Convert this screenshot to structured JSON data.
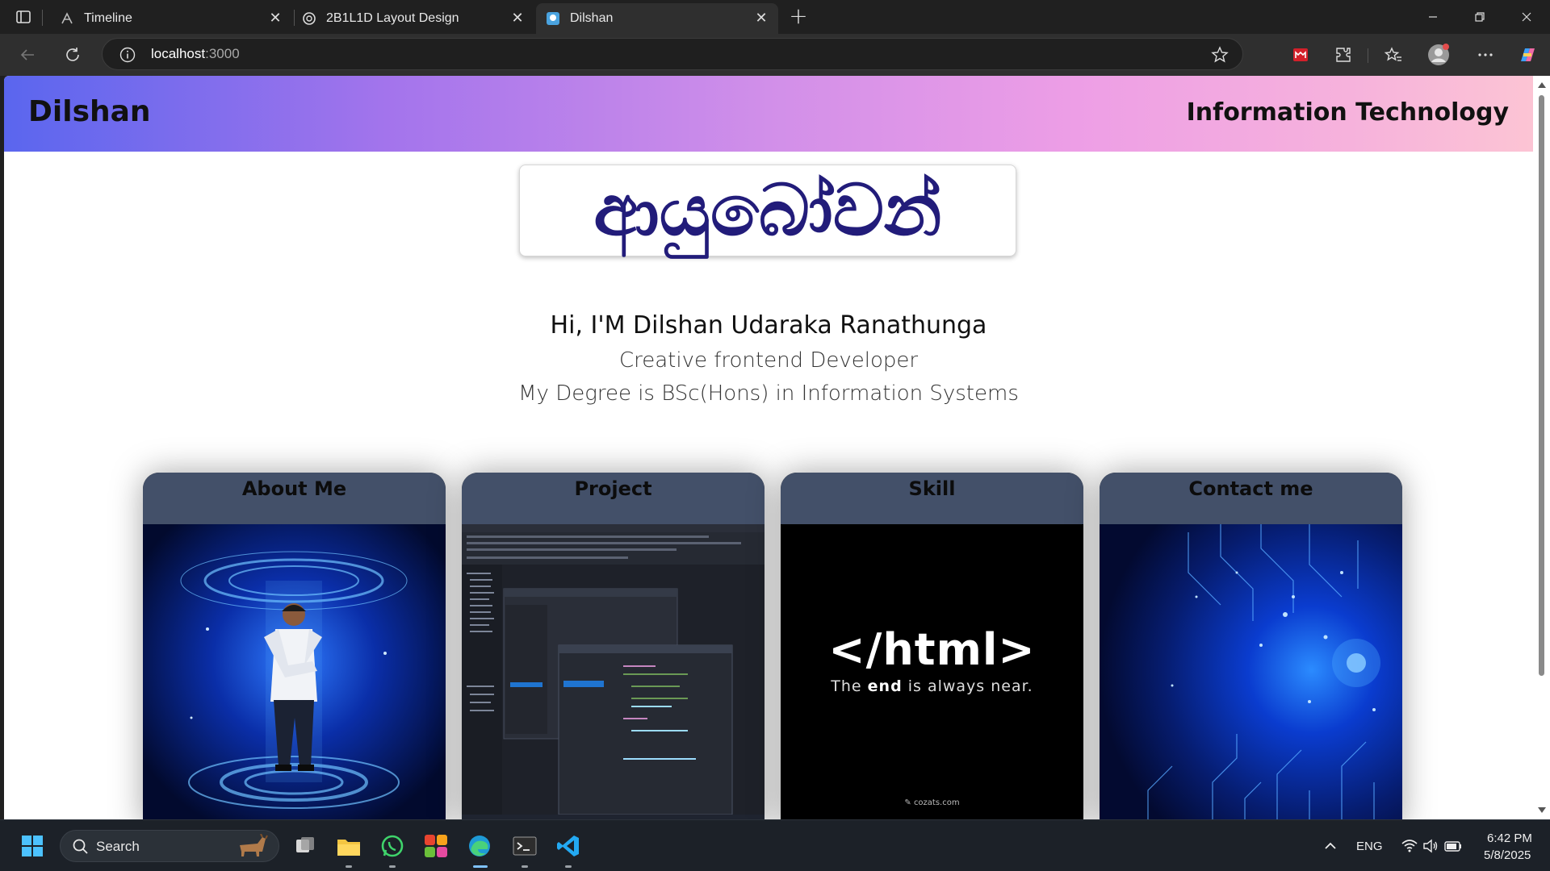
{
  "browser": {
    "tabs": [
      {
        "title": "Timeline",
        "icon": "timeline-icon"
      },
      {
        "title": "2B1L1D Layout Design",
        "icon": "openai-icon"
      },
      {
        "title": "Dilshan",
        "icon": "site-favicon"
      }
    ],
    "url_host": "localhost",
    "url_port": ":3000"
  },
  "site": {
    "brand": "Dilshan",
    "header_right": "Information Technology",
    "welcome": "ආයුබෝවන්",
    "intro": {
      "name": "Hi, I'M Dilshan Udaraka Ranathunga",
      "role": "Creative frontend Developer",
      "degree": "My Degree is BSc(Hons) in Information Systems"
    },
    "cards": [
      {
        "title": "About Me"
      },
      {
        "title": "Project"
      },
      {
        "title": "Skill",
        "image_text": "</html>",
        "image_tagline_pre": "The ",
        "image_tagline_bold": "end",
        "image_tagline_post": " is always near.",
        "image_credit": "cozats.com"
      },
      {
        "title": "Contact me"
      }
    ]
  },
  "taskbar": {
    "search_label": "Search",
    "language": "ENG",
    "time": "6:42 PM",
    "date": "5/8/2025"
  }
}
